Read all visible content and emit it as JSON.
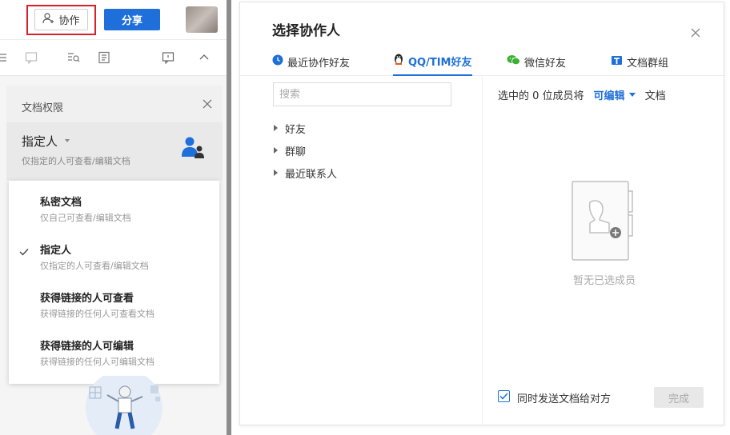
{
  "topbar": {
    "collab_label": "协作",
    "share_label": "分享"
  },
  "permission_panel": {
    "title": "文档权限",
    "current": {
      "title": "指定人",
      "desc": "仅指定的人可查看/编辑文档"
    },
    "options": [
      {
        "label": "私密文档",
        "desc": "仅自己可查看/编辑文档",
        "selected": false
      },
      {
        "label": "指定人",
        "desc": "仅指定的人可查看/编辑文档",
        "selected": true
      },
      {
        "label": "获得链接的人可查看",
        "desc": "获得链接的任何人可查看文档",
        "selected": false
      },
      {
        "label": "获得链接的人可编辑",
        "desc": "获得链接的任何人可编辑文档",
        "selected": false
      }
    ]
  },
  "dialog": {
    "title": "选择协作人",
    "tabs": [
      {
        "label": "最近协作好友",
        "icon": "clock-icon",
        "active": false
      },
      {
        "label": "QQ/TIM好友",
        "icon": "qq-penguin-icon",
        "active": true
      },
      {
        "label": "微信好友",
        "icon": "wechat-icon",
        "active": false
      },
      {
        "label": "文档群组",
        "icon": "group-docs-icon",
        "active": false
      }
    ],
    "search_placeholder": "搜索",
    "tree": [
      "好友",
      "群聊",
      "最近联系人"
    ],
    "selection": {
      "prefix": "选中的 0 位成员将",
      "permission": "可编辑",
      "suffix": "文档"
    },
    "empty_text": "暂无已选成员",
    "send_label": "同时发送文档给对方",
    "send_checked": true,
    "done_label": "完成"
  },
  "colors": {
    "accent": "#1e6fd9",
    "highlight": "#d61f26",
    "divider": "#8c8c8c"
  }
}
